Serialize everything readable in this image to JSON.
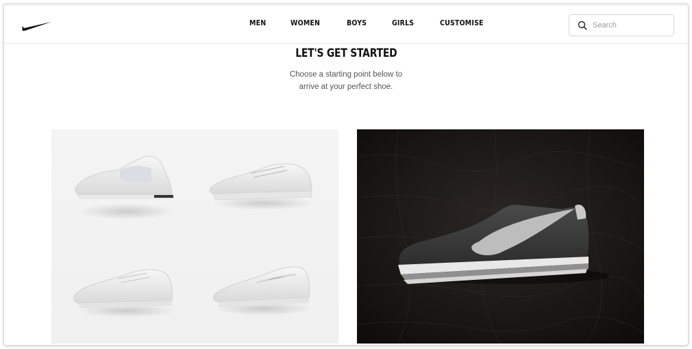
{
  "header": {
    "logo_icon": "nike-swoosh-icon",
    "nav": [
      "MEN",
      "WOMEN",
      "BOYS",
      "GIRLS",
      "CUSTOMISE"
    ],
    "search": {
      "placeholder": "Search",
      "icon": "search-icon"
    }
  },
  "main": {
    "title": "LET'S GET STARTED",
    "subtitle_line1": "Choose a starting point below to",
    "subtitle_line2": "arrive at your perfect shoe."
  },
  "cards": [
    {
      "name": "shoe-collection-card",
      "images": [
        "slip-on-shoe",
        "running-shoe",
        "training-shoe",
        "knit-running-shoe"
      ],
      "background": "#f2f2f2"
    },
    {
      "name": "classic-leather-shoe-card",
      "images": [
        "cortez-shoe"
      ],
      "background": "#1a1715",
      "accent": "#3a3a3a"
    }
  ]
}
